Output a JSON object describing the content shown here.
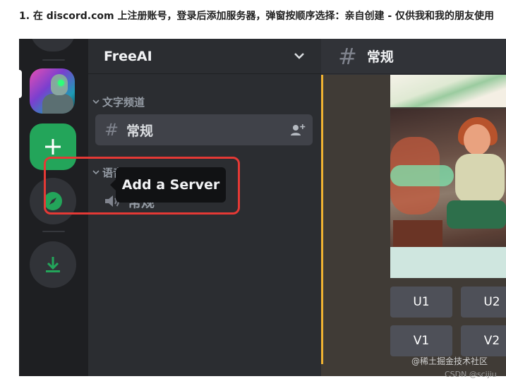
{
  "caption": "1. 在 discord.com 上注册账号，登录后添加服务器，弹窗按顺序选择：亲自创建 - 仅供我和我的朋友使用",
  "rail": {
    "items": [
      {
        "name": "server-freeai",
        "selected": true
      },
      {
        "name": "add-server",
        "icon": "plus-icon",
        "tooltip": "Add a Server",
        "highlighted": true
      },
      {
        "name": "explore",
        "icon": "compass-icon"
      },
      {
        "name": "download",
        "icon": "download-icon"
      }
    ]
  },
  "sidebar": {
    "server_name": "FreeAI",
    "header_icon": "chevron-down-icon",
    "categories": [
      {
        "label": "文字频道",
        "channels": [
          {
            "icon": "hash-icon",
            "label": "常规",
            "active": true,
            "action_icon": "invite-icon"
          }
        ]
      },
      {
        "label": "语音频道",
        "channels": [
          {
            "icon": "speaker-icon",
            "label": "常规",
            "active": false
          }
        ]
      }
    ]
  },
  "main": {
    "channel_icon": "hash-icon",
    "channel_name": "常规",
    "buttons": {
      "u1": "U1",
      "u2": "U2",
      "v1": "V1",
      "v2": "V2"
    }
  },
  "watermarks": {
    "line1": "@稀土掘金技术社区",
    "line2": "CSDN @scijiu"
  },
  "colors": {
    "add_button": "#23a55a",
    "highlight_border": "#e53935",
    "accent_line": "#f0b232"
  }
}
